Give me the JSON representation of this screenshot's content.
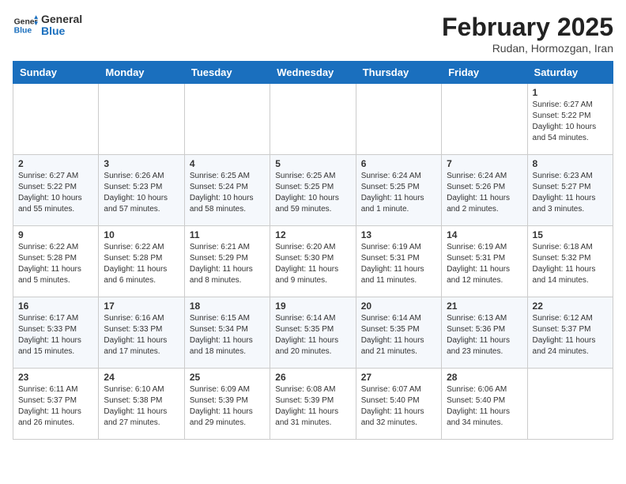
{
  "header": {
    "logo": {
      "general": "General",
      "blue": "Blue"
    },
    "title": "February 2025",
    "subtitle": "Rudan, Hormozgan, Iran"
  },
  "weekdays": [
    "Sunday",
    "Monday",
    "Tuesday",
    "Wednesday",
    "Thursday",
    "Friday",
    "Saturday"
  ],
  "weeks": [
    [
      {
        "day": "",
        "info": ""
      },
      {
        "day": "",
        "info": ""
      },
      {
        "day": "",
        "info": ""
      },
      {
        "day": "",
        "info": ""
      },
      {
        "day": "",
        "info": ""
      },
      {
        "day": "",
        "info": ""
      },
      {
        "day": "1",
        "info": "Sunrise: 6:27 AM\nSunset: 5:22 PM\nDaylight: 10 hours and 54 minutes."
      }
    ],
    [
      {
        "day": "2",
        "info": "Sunrise: 6:27 AM\nSunset: 5:22 PM\nDaylight: 10 hours and 55 minutes."
      },
      {
        "day": "3",
        "info": "Sunrise: 6:26 AM\nSunset: 5:23 PM\nDaylight: 10 hours and 57 minutes."
      },
      {
        "day": "4",
        "info": "Sunrise: 6:25 AM\nSunset: 5:24 PM\nDaylight: 10 hours and 58 minutes."
      },
      {
        "day": "5",
        "info": "Sunrise: 6:25 AM\nSunset: 5:25 PM\nDaylight: 10 hours and 59 minutes."
      },
      {
        "day": "6",
        "info": "Sunrise: 6:24 AM\nSunset: 5:25 PM\nDaylight: 11 hours and 1 minute."
      },
      {
        "day": "7",
        "info": "Sunrise: 6:24 AM\nSunset: 5:26 PM\nDaylight: 11 hours and 2 minutes."
      },
      {
        "day": "8",
        "info": "Sunrise: 6:23 AM\nSunset: 5:27 PM\nDaylight: 11 hours and 3 minutes."
      }
    ],
    [
      {
        "day": "9",
        "info": "Sunrise: 6:22 AM\nSunset: 5:28 PM\nDaylight: 11 hours and 5 minutes."
      },
      {
        "day": "10",
        "info": "Sunrise: 6:22 AM\nSunset: 5:28 PM\nDaylight: 11 hours and 6 minutes."
      },
      {
        "day": "11",
        "info": "Sunrise: 6:21 AM\nSunset: 5:29 PM\nDaylight: 11 hours and 8 minutes."
      },
      {
        "day": "12",
        "info": "Sunrise: 6:20 AM\nSunset: 5:30 PM\nDaylight: 11 hours and 9 minutes."
      },
      {
        "day": "13",
        "info": "Sunrise: 6:19 AM\nSunset: 5:31 PM\nDaylight: 11 hours and 11 minutes."
      },
      {
        "day": "14",
        "info": "Sunrise: 6:19 AM\nSunset: 5:31 PM\nDaylight: 11 hours and 12 minutes."
      },
      {
        "day": "15",
        "info": "Sunrise: 6:18 AM\nSunset: 5:32 PM\nDaylight: 11 hours and 14 minutes."
      }
    ],
    [
      {
        "day": "16",
        "info": "Sunrise: 6:17 AM\nSunset: 5:33 PM\nDaylight: 11 hours and 15 minutes."
      },
      {
        "day": "17",
        "info": "Sunrise: 6:16 AM\nSunset: 5:33 PM\nDaylight: 11 hours and 17 minutes."
      },
      {
        "day": "18",
        "info": "Sunrise: 6:15 AM\nSunset: 5:34 PM\nDaylight: 11 hours and 18 minutes."
      },
      {
        "day": "19",
        "info": "Sunrise: 6:14 AM\nSunset: 5:35 PM\nDaylight: 11 hours and 20 minutes."
      },
      {
        "day": "20",
        "info": "Sunrise: 6:14 AM\nSunset: 5:35 PM\nDaylight: 11 hours and 21 minutes."
      },
      {
        "day": "21",
        "info": "Sunrise: 6:13 AM\nSunset: 5:36 PM\nDaylight: 11 hours and 23 minutes."
      },
      {
        "day": "22",
        "info": "Sunrise: 6:12 AM\nSunset: 5:37 PM\nDaylight: 11 hours and 24 minutes."
      }
    ],
    [
      {
        "day": "23",
        "info": "Sunrise: 6:11 AM\nSunset: 5:37 PM\nDaylight: 11 hours and 26 minutes."
      },
      {
        "day": "24",
        "info": "Sunrise: 6:10 AM\nSunset: 5:38 PM\nDaylight: 11 hours and 27 minutes."
      },
      {
        "day": "25",
        "info": "Sunrise: 6:09 AM\nSunset: 5:39 PM\nDaylight: 11 hours and 29 minutes."
      },
      {
        "day": "26",
        "info": "Sunrise: 6:08 AM\nSunset: 5:39 PM\nDaylight: 11 hours and 31 minutes."
      },
      {
        "day": "27",
        "info": "Sunrise: 6:07 AM\nSunset: 5:40 PM\nDaylight: 11 hours and 32 minutes."
      },
      {
        "day": "28",
        "info": "Sunrise: 6:06 AM\nSunset: 5:40 PM\nDaylight: 11 hours and 34 minutes."
      },
      {
        "day": "",
        "info": ""
      }
    ]
  ]
}
